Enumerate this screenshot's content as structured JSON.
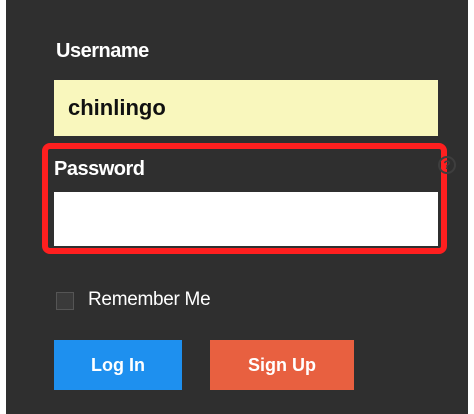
{
  "login_form": {
    "username_label": "Username",
    "username_value": "chinlingo",
    "password_label": "Password",
    "password_value": "",
    "help_icon": "question-circle-icon",
    "remember_label": "Remember Me",
    "remember_checked": false,
    "login_label": "Log In",
    "signup_label": "Sign Up"
  },
  "colors": {
    "panel_bg": "#2f2f2f",
    "username_field_bg": "#f9f7bd",
    "highlight_border": "#ff1f1f",
    "login_button": "#1e90ef",
    "signup_button": "#e86040"
  }
}
